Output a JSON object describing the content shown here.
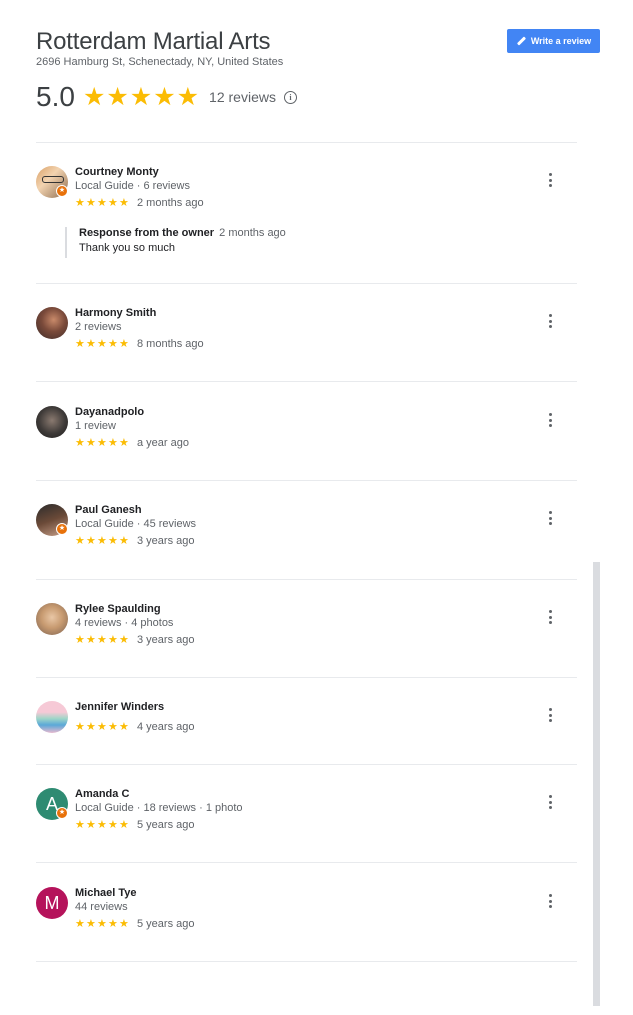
{
  "business": {
    "name": "Rotterdam Martial Arts",
    "address": "2696 Hamburg St, Schenectady, NY, United States",
    "rating": "5.0",
    "review_count": "12 reviews",
    "stars": 5
  },
  "write_review_label": "Write a review",
  "colors": {
    "star": "#fbbc04",
    "button": "#4285f4",
    "local_guide_badge": "#e8710a"
  },
  "reviews": [
    {
      "name": "Courtney Monty",
      "meta": "Local Guide · 6 reviews",
      "time": "2 months ago",
      "stars": 5,
      "local_guide": true,
      "owner_response": {
        "title": "Response from the owner",
        "time": "2 months ago",
        "text": "Thank you so much"
      }
    },
    {
      "name": "Harmony Smith",
      "meta": "2 reviews",
      "time": "8 months ago",
      "stars": 5,
      "local_guide": false
    },
    {
      "name": "Dayanadpolo",
      "meta": "1 review",
      "time": "a year ago",
      "stars": 5,
      "local_guide": false
    },
    {
      "name": "Paul Ganesh",
      "meta": "Local Guide · 45 reviews",
      "time": "3 years ago",
      "stars": 5,
      "local_guide": true
    },
    {
      "name": "Rylee Spaulding",
      "meta": "4 reviews · 4 photos",
      "time": "3 years ago",
      "stars": 5,
      "local_guide": false
    },
    {
      "name": "Jennifer Winders",
      "meta": "",
      "time": "4 years ago",
      "stars": 5,
      "local_guide": false
    },
    {
      "name": "Amanda C",
      "meta": "Local Guide · 18 reviews · 1 photo",
      "time": "5 years ago",
      "stars": 5,
      "local_guide": true,
      "avatar_letter": "A",
      "avatar_color": "#2e8b72"
    },
    {
      "name": "Michael Tye",
      "meta": "44 reviews",
      "time": "5 years ago",
      "stars": 5,
      "local_guide": false,
      "avatar_letter": "M",
      "avatar_color": "#b5135b"
    }
  ]
}
